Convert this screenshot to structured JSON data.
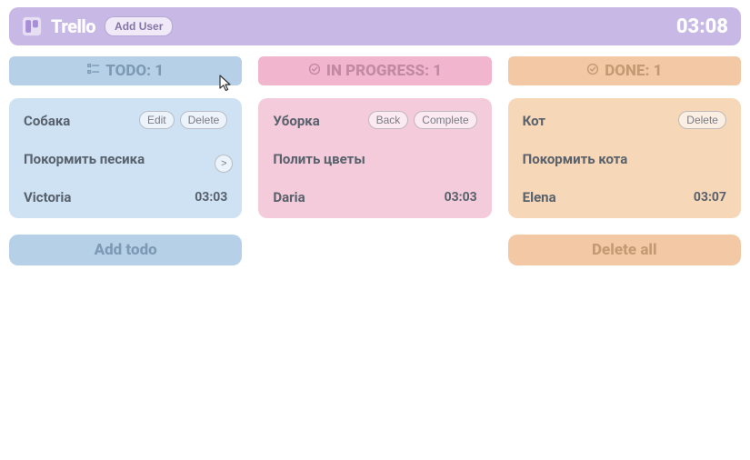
{
  "header": {
    "logo_text": "Trello",
    "add_user_label": "Add User",
    "clock": "03:08"
  },
  "columns": {
    "todo": {
      "title": "TODO: 1",
      "action_label": "Add todo"
    },
    "progress": {
      "title": "IN PROGRESS: 1"
    },
    "done": {
      "title": "DONE: 1",
      "action_label": "Delete all"
    }
  },
  "cards": {
    "todo": {
      "title": "Собака",
      "desc": "Покормить песика",
      "author": "Victoria",
      "time": "03:03",
      "edit_label": "Edit",
      "delete_label": "Delete",
      "forward_label": ">"
    },
    "progress": {
      "title": "Уборка",
      "desc": "Полить цветы",
      "author": "Daria",
      "time": "03:03",
      "back_label": "Back",
      "complete_label": "Complete"
    },
    "done": {
      "title": "Кот",
      "desc": "Покормить кота",
      "author": "Elena",
      "time": "03:07",
      "delete_label": "Delete"
    }
  }
}
